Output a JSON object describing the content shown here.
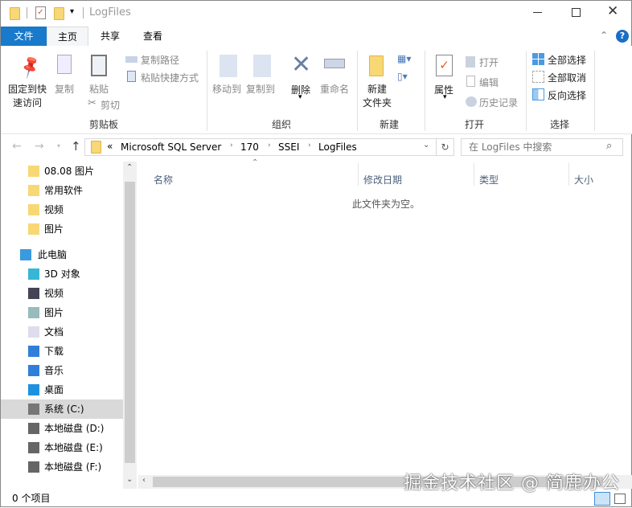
{
  "window": {
    "title": "LogFiles"
  },
  "tabs": [
    {
      "label": "文件"
    },
    {
      "label": "主页"
    },
    {
      "label": "共享"
    },
    {
      "label": "查看"
    }
  ],
  "ribbon": {
    "clipboard": {
      "pin": "固定到快",
      "pin2": "速访问",
      "copy": "复制",
      "paste": "粘贴",
      "copy_path": "复制路径",
      "paste_shortcut": "粘贴快捷方式",
      "cut": "剪切",
      "group": "剪贴板"
    },
    "organize": {
      "move_to": "移动到",
      "copy_to": "复制到",
      "delete": "删除",
      "rename": "重命名",
      "group": "组织"
    },
    "new": {
      "new_folder": "新建",
      "new_folder2": "文件夹",
      "group": "新建"
    },
    "open": {
      "properties": "属性",
      "open": "打开",
      "edit": "编辑",
      "history": "历史记录",
      "group": "打开"
    },
    "select": {
      "select_all": "全部选择",
      "select_none": "全部取消",
      "invert": "反向选择",
      "group": "选择"
    }
  },
  "address": {
    "overflow": "«",
    "crumbs": [
      "Microsoft SQL Server",
      "170",
      "SSEI",
      "LogFiles"
    ]
  },
  "search": {
    "placeholder": "在 LogFiles 中搜索"
  },
  "nav": {
    "quick": [
      "08.08 图片",
      "常用软件",
      "视频",
      "图片"
    ],
    "this_pc": "此电脑",
    "pc_items": [
      "3D 对象",
      "视频",
      "图片",
      "文档",
      "下载",
      "音乐",
      "桌面",
      "系统 (C:)",
      "本地磁盘 (D:)",
      "本地磁盘 (E:)",
      "本地磁盘 (F:)"
    ]
  },
  "columns": [
    "名称",
    "修改日期",
    "类型",
    "大小"
  ],
  "empty_message": "此文件夹为空。",
  "status": {
    "count": "0 个项目"
  },
  "watermark": "掘金技术社区 @ 简鹿办公",
  "colors": {
    "accent": "#1979ca",
    "selected": "#d9d9d9"
  }
}
